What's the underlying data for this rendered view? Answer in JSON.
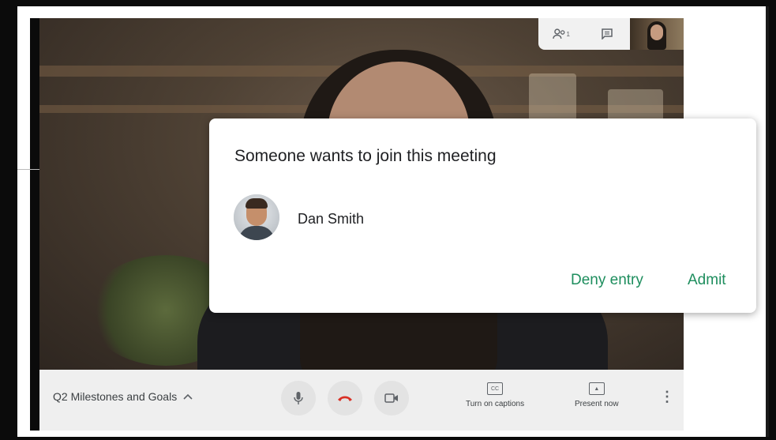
{
  "top_controls": {
    "participants_icon": "people-icon",
    "participants_count": "1",
    "chat_icon": "chat-icon"
  },
  "dialog": {
    "title": "Someone wants to join this meeting",
    "requester_name": "Dan Smith",
    "deny_label": "Deny entry",
    "admit_label": "Admit"
  },
  "toolbar": {
    "meeting_name": "Q2 Milestones and Goals",
    "captions_label": "Turn on captions",
    "present_label": "Present now",
    "mic_icon": "microphone-icon",
    "hangup_icon": "hangup-icon",
    "camera_icon": "camera-icon",
    "more_icon": "more-vert-icon"
  },
  "colors": {
    "accent": "#1e8e5e",
    "hangup": "#d93025"
  }
}
